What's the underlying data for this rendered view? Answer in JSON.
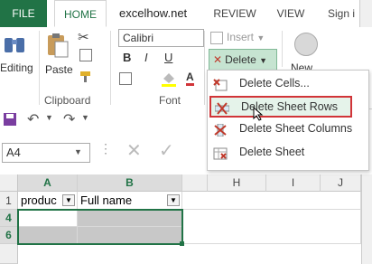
{
  "colors": {
    "accent": "#217346",
    "highlight_border": "#d13438",
    "delete_red": "#c0392b"
  },
  "tabs": {
    "file": "FILE",
    "home": "HOME",
    "review": "REVIEW",
    "view": "VIEW",
    "signin": "Sign i"
  },
  "document_title": "excelhow.net",
  "ribbon": {
    "editing_label": "Editing",
    "paste_label": "Paste",
    "clipboard_label": "Clipboard",
    "font_name": "Calibri",
    "bold": "B",
    "italic": "I",
    "underline": "U",
    "font_label": "Font",
    "insert_label": "Insert",
    "delete_label": "Delete",
    "new_label": "New"
  },
  "delete_menu": {
    "items": [
      {
        "label": "Delete Cells...",
        "icon": "delete-cells-icon"
      },
      {
        "label": "Delete Sheet Rows",
        "icon": "delete-rows-icon"
      },
      {
        "label": "Delete Sheet Columns",
        "icon": "delete-columns-icon"
      },
      {
        "label": "Delete Sheet",
        "icon": "delete-sheet-icon"
      }
    ]
  },
  "formula_bar": {
    "name_box": "A4",
    "cancel": "✕",
    "enter": "✓"
  },
  "grid": {
    "columns": [
      "A",
      "B",
      "H",
      "I",
      "J"
    ],
    "rows": [
      "1",
      "4",
      "6"
    ],
    "header_cells": [
      "produc",
      "Full name"
    ]
  }
}
